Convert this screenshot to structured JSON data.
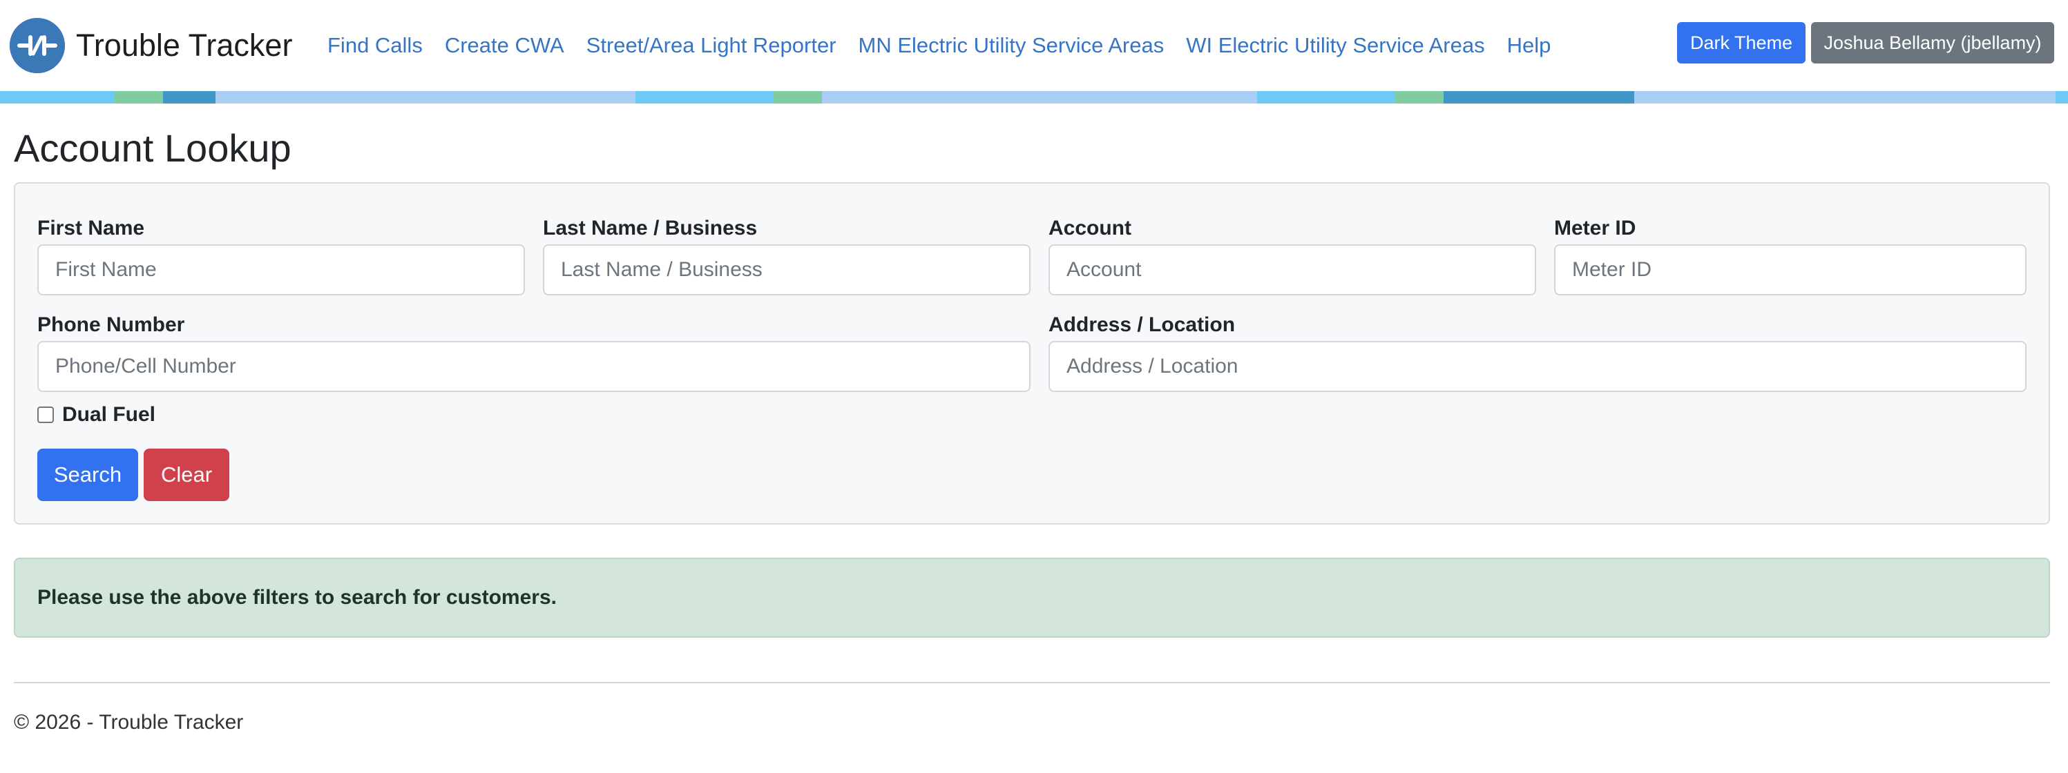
{
  "app": {
    "brand": "Trouble Tracker",
    "logo_icon": "plug-icon",
    "colors": {
      "accent": "#3272f0",
      "danger": "#d0414c",
      "secondary": "#6c757d",
      "link": "#3674c5",
      "success_bg": "#d4e6dc",
      "strip": [
        "#6ccaf5",
        "#7fcca0",
        "#4297c9",
        "#a9cdf5"
      ]
    }
  },
  "nav": {
    "links": [
      "Find Calls",
      "Create CWA",
      "Street/Area Light Reporter",
      "MN Electric Utility Service Areas",
      "WI Electric Utility Service Areas",
      "Help"
    ],
    "theme_button": "Dark Theme",
    "user_button": "Joshua Bellamy (jbellamy)"
  },
  "page": {
    "title": "Account Lookup"
  },
  "form": {
    "first_name": {
      "label": "First Name",
      "placeholder": "First Name",
      "value": ""
    },
    "last_name": {
      "label": "Last Name / Business",
      "placeholder": "Last Name / Business",
      "value": ""
    },
    "account": {
      "label": "Account",
      "placeholder": "Account",
      "value": ""
    },
    "meter_id": {
      "label": "Meter ID",
      "placeholder": "Meter ID",
      "value": ""
    },
    "phone": {
      "label": "Phone Number",
      "placeholder": "Phone/Cell Number",
      "value": ""
    },
    "address": {
      "label": "Address / Location",
      "placeholder": "Address / Location",
      "value": ""
    },
    "dual_fuel": {
      "label": "Dual Fuel",
      "checked": false
    },
    "search_button": "Search",
    "clear_button": "Clear"
  },
  "alert": {
    "message": "Please use the above filters to search for customers."
  },
  "footer": {
    "text": "© 2026 - Trouble Tracker"
  }
}
